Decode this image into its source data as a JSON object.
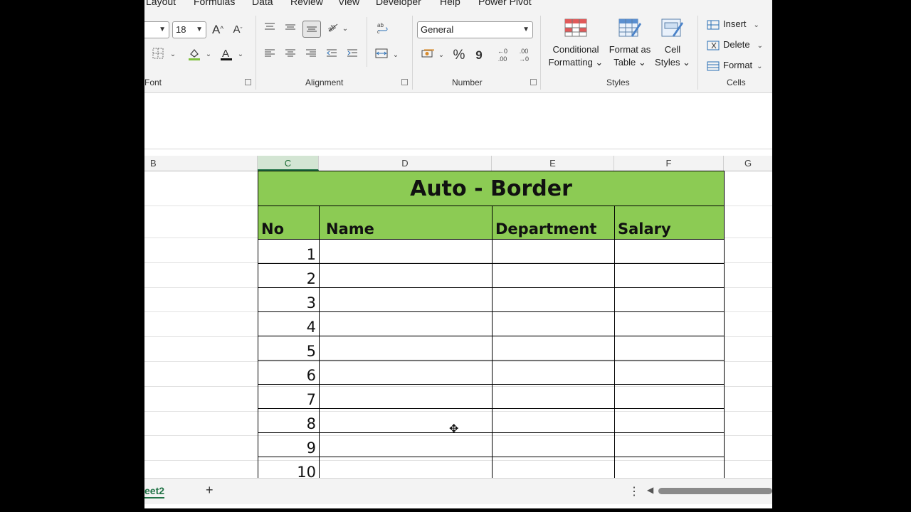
{
  "ribbon_tabs": [
    "Layout",
    "Formulas",
    "Data",
    "Review",
    "View",
    "Developer",
    "Help",
    "Power Pivot"
  ],
  "font": {
    "size_value": "18",
    "group_label": "Font",
    "grow_label": "A^",
    "shrink_label": "A",
    "font_color_glyph": "A",
    "fill_color": "#7fbf3f",
    "font_color": "#111111"
  },
  "alignment": {
    "group_label": "Alignment"
  },
  "number": {
    "format_value": "General",
    "group_label": "Number",
    "percent_label": "%",
    "comma_label": "9",
    "inc_decimal_label": "←0 .00",
    "dec_decimal_label": ".00 →0"
  },
  "styles": {
    "group_label": "Styles",
    "conditional": [
      "Conditional",
      "Formatting ⌄"
    ],
    "format_table": [
      "Format as",
      "Table ⌄"
    ],
    "cell_styles": [
      "Cell",
      "Styles ⌄"
    ]
  },
  "cells": {
    "group_label": "Cells",
    "insert_label": "Insert",
    "delete_label": "Delete",
    "format_label": "Format"
  },
  "columns": [
    "B",
    "C",
    "D",
    "E",
    "F",
    "G"
  ],
  "selected_column": "C",
  "table": {
    "title": "Auto - Border",
    "headers": [
      "No",
      "Name",
      "Department",
      "Salary"
    ],
    "rows": [
      "1",
      "2",
      "3",
      "4",
      "5",
      "6",
      "7",
      "8",
      "9",
      "10"
    ],
    "header_fill": "#8ccb54"
  },
  "sheet_tab_label": "eet2",
  "add_sheet_label": "+"
}
